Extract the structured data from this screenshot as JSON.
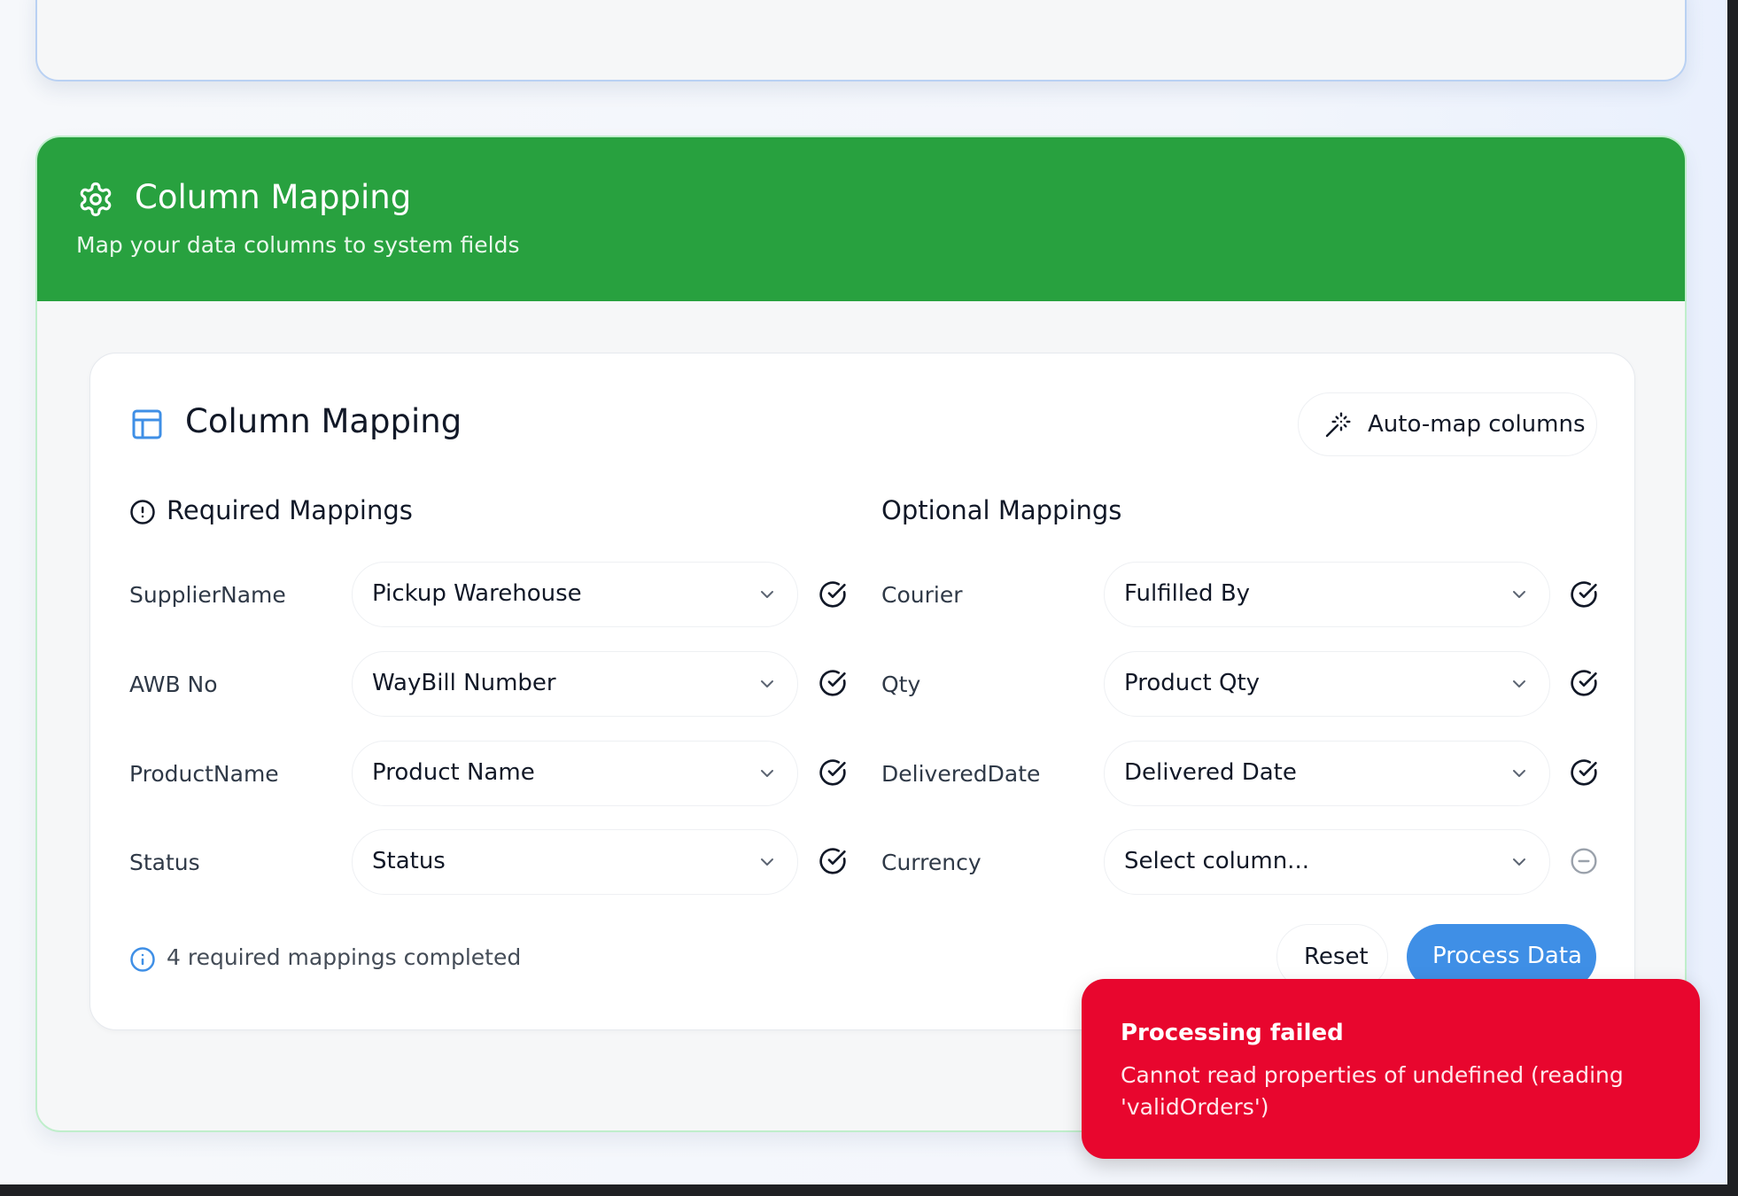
{
  "section": {
    "title": "Column Mapping",
    "subtitle": "Map your data columns to system fields"
  },
  "card": {
    "title": "Column Mapping",
    "automap_label": "Auto-map columns"
  },
  "required": {
    "title": "Required Mappings",
    "rows": [
      {
        "label": "SupplierName",
        "value": "Pickup Warehouse",
        "status": "mapped"
      },
      {
        "label": "AWB No",
        "value": "WayBill Number",
        "status": "mapped"
      },
      {
        "label": "ProductName",
        "value": "Product Name",
        "status": "mapped"
      },
      {
        "label": "Status",
        "value": "Status",
        "status": "mapped"
      }
    ]
  },
  "optional": {
    "title": "Optional Mappings",
    "rows": [
      {
        "label": "Courier",
        "value": "Fulfilled By",
        "status": "mapped"
      },
      {
        "label": "Qty",
        "value": "Product Qty",
        "status": "mapped"
      },
      {
        "label": "DeliveredDate",
        "value": "Delivered Date",
        "status": "mapped"
      },
      {
        "label": "Currency",
        "value": "Select column...",
        "status": "unmapped"
      }
    ]
  },
  "footer": {
    "status_text": "4 required mappings completed",
    "reset_label": "Reset",
    "process_label": "Process Data"
  },
  "toast": {
    "title": "Processing failed",
    "message": "Cannot read properties of undefined (reading 'validOrders')"
  },
  "colors": {
    "header_green": "#28a13f",
    "primary_blue": "#3f8fe6",
    "error_red": "#e8062e"
  },
  "icons": {
    "section": "gear-icon",
    "card": "table-icon",
    "automap": "magic-wand-icon",
    "required": "alert-circle-icon",
    "mapped": "check-circle-icon",
    "unmapped": "minus-circle-icon",
    "footer": "info-icon"
  }
}
